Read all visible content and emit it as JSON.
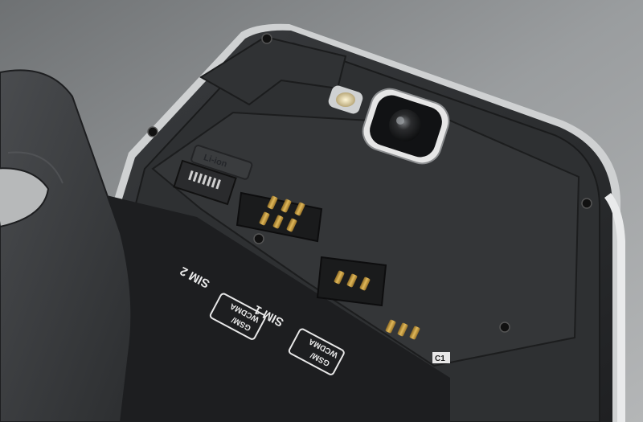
{
  "labels": {
    "sim2": "SIM 2",
    "sim1": "SIM 1",
    "gsm_wcdma_line1": "GSM/",
    "gsm_wcdma_line2": "WCDMA",
    "slot_marker": "C1",
    "battery_marker": "Li-ion"
  },
  "colors": {
    "background": "#8f9294",
    "phone_body": "#2a2c2e",
    "phone_frame": "#d9dbdc",
    "battery_cover": "#3a3c3e",
    "gold_contacts": "#c8a04a",
    "camera_ring": "#e6e6e6",
    "flash": "#e8e0c8"
  },
  "icons": {
    "camera": "camera-lens-icon",
    "flash": "led-flash-icon",
    "screw": "screw-icon"
  }
}
